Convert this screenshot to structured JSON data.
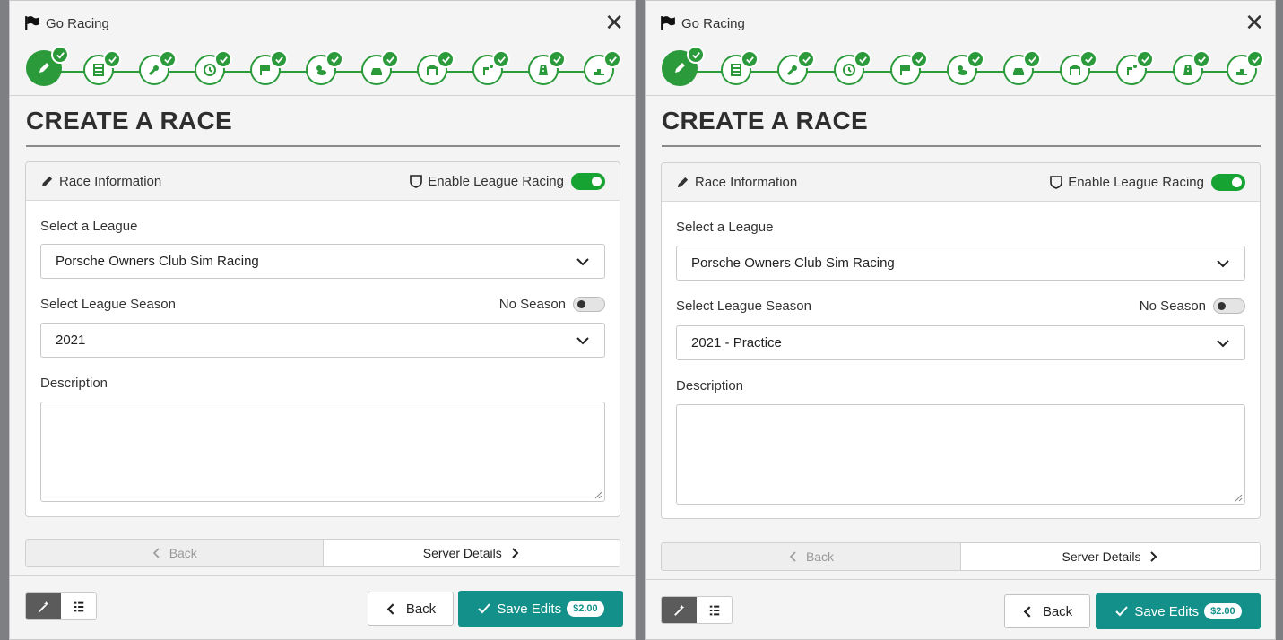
{
  "app": {
    "title": "Go Racing"
  },
  "page": {
    "title": "CREATE A RACE"
  },
  "steps": [
    {
      "icon": "pencil-icon",
      "state": "active",
      "completed": true
    },
    {
      "icon": "server-list-icon",
      "state": "done",
      "completed": true
    },
    {
      "icon": "key-icon",
      "state": "done",
      "completed": true
    },
    {
      "icon": "clock-icon",
      "state": "done",
      "completed": true
    },
    {
      "icon": "flag-icon",
      "state": "done",
      "completed": true
    },
    {
      "icon": "weather-icon",
      "state": "done",
      "completed": true
    },
    {
      "icon": "cars-icon",
      "state": "done",
      "completed": true
    },
    {
      "icon": "garage-icon",
      "state": "done",
      "completed": true
    },
    {
      "icon": "pit-flag-icon",
      "state": "done",
      "completed": true
    },
    {
      "icon": "track-icon",
      "state": "done",
      "completed": true
    },
    {
      "icon": "podium-icon",
      "state": "done",
      "completed": true
    }
  ],
  "card": {
    "header": "Race Information",
    "league_toggle_label": "Enable League Racing",
    "league_toggle_on": true
  },
  "fields": {
    "league_label": "Select a League",
    "season_label": "Select League Season",
    "no_season_label": "No Season",
    "no_season_on": false,
    "description_label": "Description"
  },
  "panels": {
    "left": {
      "league_value": "Porsche Owners Club Sim Racing",
      "season_value": "2021",
      "description_value": ""
    },
    "right": {
      "league_value": "Porsche Owners Club Sim Racing",
      "season_value": "2021 - Practice",
      "description_value": ""
    }
  },
  "nav": {
    "back_label": "Back",
    "next_label": "Server Details"
  },
  "footer": {
    "back_label": "Back",
    "save_label": "Save Edits",
    "price": "$2.00"
  },
  "colors": {
    "green": "#2a9a3a",
    "toggle_green": "#16a332",
    "teal": "#13908a"
  }
}
